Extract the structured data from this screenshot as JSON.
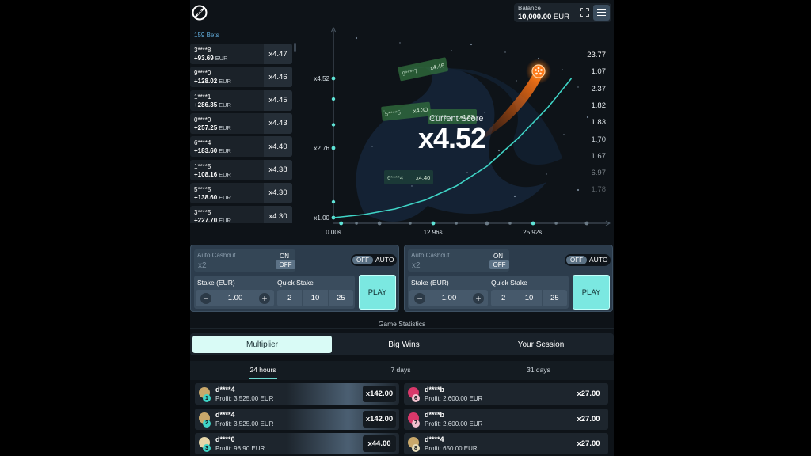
{
  "header": {
    "balance_label": "Balance",
    "balance_value": "10,000.00",
    "balance_currency": "EUR",
    "logo_icon": "slashed-circle-logo",
    "fullscreen_icon": "fullscreen-icon",
    "menu_icon": "hamburger-menu-icon"
  },
  "bets": {
    "count_label": "159 Bets",
    "rows": [
      {
        "user": "3****8",
        "profit": "+93.69",
        "currency": "EUR",
        "mult": "x4.47"
      },
      {
        "user": "9****0",
        "profit": "+128.02",
        "currency": "EUR",
        "mult": "x4.46"
      },
      {
        "user": "1****1",
        "profit": "+286.35",
        "currency": "EUR",
        "mult": "x4.45"
      },
      {
        "user": "0****0",
        "profit": "+257.25",
        "currency": "EUR",
        "mult": "x4.43"
      },
      {
        "user": "6****4",
        "profit": "+183.60",
        "currency": "EUR",
        "mult": "x4.40"
      },
      {
        "user": "1****5",
        "profit": "+108.16",
        "currency": "EUR",
        "mult": "x4.38"
      },
      {
        "user": "5****5",
        "profit": "+138.60",
        "currency": "EUR",
        "mult": "x4.30"
      },
      {
        "user": "3****5",
        "profit": "+227.70",
        "currency": "EUR",
        "mult": "x4.30"
      }
    ]
  },
  "game": {
    "score_label": "Current Score",
    "score_value": "x4.52",
    "rocket_icon": "glowing-ball-icon",
    "recent_multipliers": [
      "23.77",
      "1.07",
      "2.37",
      "1.82",
      "1.83",
      "1.70",
      "1.67",
      "6.97",
      "1.78"
    ],
    "floating_cashouts": [
      {
        "user": "9****7",
        "mult": "x4.46"
      },
      {
        "user": "5****5",
        "mult": "x4.30"
      },
      {
        "user": "6****4",
        "mult": "x4.40"
      },
      {
        "user": "5****9",
        "mult": "x4.23"
      }
    ]
  },
  "chart_data": {
    "type": "line",
    "x_ticks": [
      "0.00s",
      "12.96s",
      "25.92s"
    ],
    "y_ticks": [
      "x1.00",
      "x2.76",
      "x4.52"
    ],
    "xlim": [
      0,
      36
    ],
    "ylim": [
      1.0,
      5.5
    ],
    "x": [
      0,
      4,
      8,
      12,
      16,
      20,
      24,
      28,
      31
    ],
    "y": [
      1.0,
      1.08,
      1.22,
      1.45,
      1.8,
      2.3,
      3.0,
      3.8,
      4.52
    ],
    "grid": false,
    "line_color": "#3fd4c6"
  },
  "panels": [
    {
      "auto_cashout_label": "Auto Cashout",
      "auto_cashout_value": "x2",
      "on_label": "ON",
      "off_label": "OFF",
      "auto_off": "OFF",
      "auto_label": "AUTO",
      "stake_label": "Stake (EUR)",
      "stake_value": "1.00",
      "minus": "−",
      "plus": "+",
      "quick_label": "Quick Stake",
      "quick": [
        "2",
        "10",
        "25"
      ],
      "play_label": "PLAY"
    },
    {
      "auto_cashout_label": "Auto Cashout",
      "auto_cashout_value": "x2",
      "on_label": "ON",
      "off_label": "OFF",
      "auto_off": "OFF",
      "auto_label": "AUTO",
      "stake_label": "Stake (EUR)",
      "stake_value": "1.00",
      "minus": "−",
      "plus": "+",
      "quick_label": "Quick Stake",
      "quick": [
        "2",
        "10",
        "25"
      ],
      "play_label": "PLAY"
    }
  ],
  "stats": {
    "title": "Game Statistics",
    "tabs": [
      "Multiplier",
      "Big Wins",
      "Your Session"
    ],
    "periods": [
      "24 hours",
      "7 days",
      "31 days"
    ],
    "left": [
      {
        "rank": "1",
        "user": "d****4",
        "profit": "Profit: 3,525.00 EUR",
        "mult": "x142.00",
        "avatar": "#c9a86a",
        "rank_color": "#3fd4c6"
      },
      {
        "rank": "2",
        "user": "d****4",
        "profit": "Profit: 3,525.00 EUR",
        "mult": "x142.00",
        "avatar": "#c9a86a",
        "rank_color": "#3fd4c6"
      },
      {
        "rank": "3",
        "user": "d****0",
        "profit": "Profit: 98.90 EUR",
        "mult": "x44.00",
        "avatar": "#e6d6a8",
        "rank_color": "#3fd4c6"
      }
    ],
    "right": [
      {
        "rank": "6",
        "user": "d****b",
        "profit": "Profit: 2,600.00 EUR",
        "mult": "x27.00",
        "avatar": "#d9386a",
        "rank_color": "#f2c1cf"
      },
      {
        "rank": "7",
        "user": "d****b",
        "profit": "Profit: 2,600.00 EUR",
        "mult": "x27.00",
        "avatar": "#d9386a",
        "rank_color": "#f2c1cf"
      },
      {
        "rank": "8",
        "user": "d****4",
        "profit": "Profit: 650.00 EUR",
        "mult": "x27.00",
        "avatar": "#c9a86a",
        "rank_color": "#e6dcb8"
      }
    ]
  }
}
